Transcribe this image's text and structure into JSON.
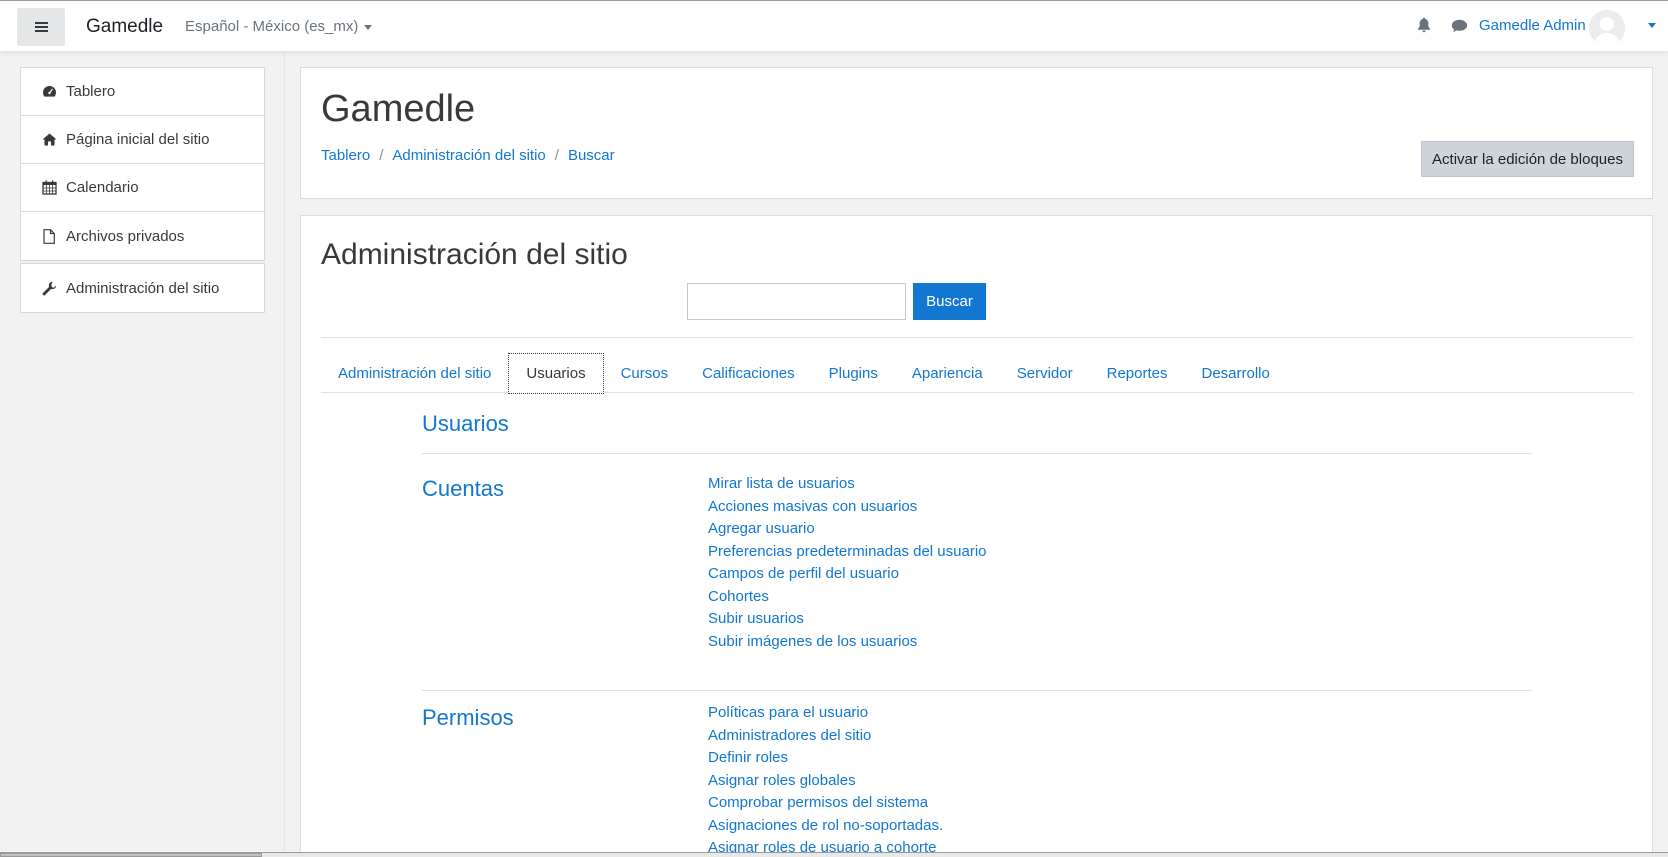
{
  "navbar": {
    "brand": "Gamedle",
    "language": "Español - México (es_mx)",
    "user_name": "Gamedle Admin",
    "icons": {
      "menu": "hamburger-icon",
      "notifications": "bell-icon",
      "messages": "chat-bubble-icon",
      "avatar": "user-avatar-icon"
    }
  },
  "drawer": {
    "primary": [
      {
        "label": "Tablero",
        "icon": "dashboard-gauge-icon"
      },
      {
        "label": "Página inicial del sitio",
        "icon": "home-icon"
      },
      {
        "label": "Calendario",
        "icon": "calendar-icon"
      },
      {
        "label": "Archivos privados",
        "icon": "file-icon"
      }
    ],
    "secondary": [
      {
        "label": "Administración del sitio",
        "icon": "wrench-icon"
      }
    ]
  },
  "header": {
    "title": "Gamedle",
    "breadcrumb": [
      "Tablero",
      "Administración del sitio",
      "Buscar"
    ],
    "edit_button": "Activar la edición de bloques"
  },
  "admin": {
    "title": "Administración del sitio",
    "search_value": "",
    "search_button": "Buscar",
    "tabs": [
      "Administración del sitio",
      "Usuarios",
      "Cursos",
      "Calificaciones",
      "Plugins",
      "Apariencia",
      "Servidor",
      "Reportes",
      "Desarrollo"
    ],
    "active_tab": "Usuarios",
    "page_heading": "Usuarios",
    "sections": [
      {
        "title": "Cuentas",
        "links": [
          "Mirar lista de usuarios",
          "Acciones masivas con usuarios",
          "Agregar usuario",
          "Preferencias predeterminadas del usuario",
          "Campos de perfil del usuario",
          "Cohortes",
          "Subir usuarios",
          "Subir imágenes de los usuarios"
        ]
      },
      {
        "title": "Permisos",
        "links": [
          "Políticas para el usuario",
          "Administradores del sitio",
          "Definir roles",
          "Asignar roles globales",
          "Comprobar permisos del sistema",
          "Asignaciones de rol no-soportadas.",
          "Asignar roles de usuario a cohorte"
        ]
      }
    ]
  },
  "colors": {
    "link": "#1177d1",
    "primary_button": "#1177d1",
    "page_bg": "#f2f2f2"
  }
}
